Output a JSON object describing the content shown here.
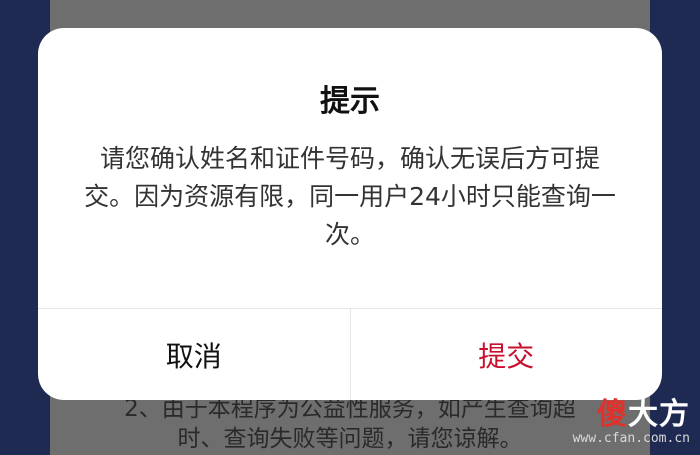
{
  "background_page": {
    "line1": "2、由于本程序为公益性服务，如产生查询超",
    "line2": "时、查询失败等问题，请您谅解。"
  },
  "dialog": {
    "title": "提示",
    "message": "请您确认姓名和证件号码，确认无误后方可提交。因为资源有限，同一用户24小时只能查询一次。",
    "cancel_label": "取消",
    "submit_label": "提交"
  },
  "watermark": {
    "logo_first": "傻",
    "logo_rest": "大方",
    "url": "www.cfan.com.cn"
  },
  "colors": {
    "submit": "#c8102e",
    "frame": "#1e2a52",
    "overlay": "#6e6e6e"
  }
}
